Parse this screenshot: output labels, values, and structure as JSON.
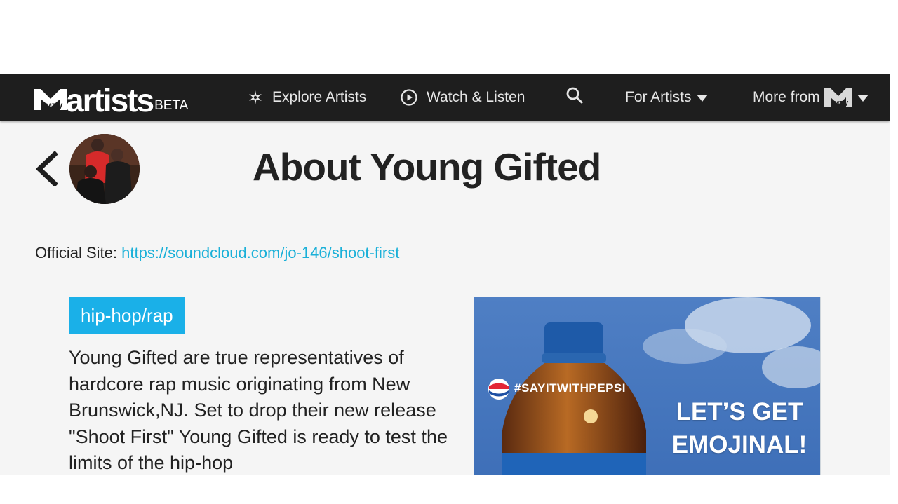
{
  "nav": {
    "brand_word": "artists",
    "brand_beta": "BETA",
    "explore_label": "Explore Artists",
    "watch_label": "Watch & Listen",
    "for_artists_label": "For Artists",
    "more_label": "More from",
    "icons": {
      "explore": "sparkle-icon",
      "watch": "play-circle-icon",
      "search": "search-icon",
      "caret": "caret-down-icon",
      "brand": "mtv-logo-icon"
    }
  },
  "artist": {
    "page_title": "About Young Gifted",
    "official_site_label": "Official Site:",
    "official_site_url": "https://soundcloud.com/jo-146/shoot-first",
    "genre": "hip-hop/rap",
    "bio": "Young Gifted are true representatives of hardcore rap music originating from New Brunswick,NJ. Set to drop their new release \"Shoot First\" Young Gifted is ready to test the limits of the hip-hop"
  },
  "ad": {
    "hashtag": "#SAYITWITHPEPSI",
    "headline": "LET’S GET EMOJINAL!"
  },
  "colors": {
    "navbar_bg": "#1e1e1e",
    "accent": "#1ab0e8",
    "link": "#1ab0d8",
    "page_bg": "#f5f5f5",
    "text": "#222222"
  }
}
